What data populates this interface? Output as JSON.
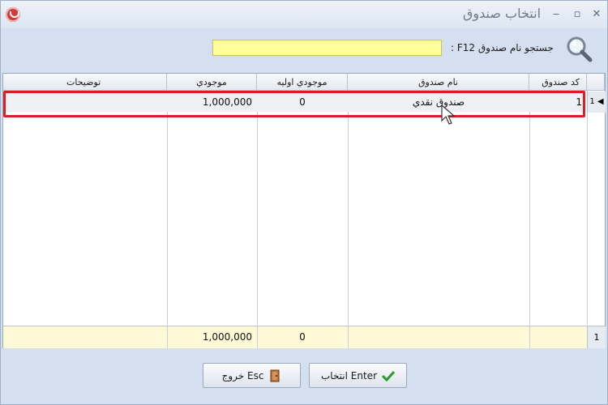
{
  "window": {
    "title": "انتخاب صندوق"
  },
  "search": {
    "label": "جستجو نام صندوق F12 :",
    "value": ""
  },
  "grid": {
    "columns": {
      "code": "کد صندوق",
      "name": "نام صندوق",
      "initial": "موجودي اوليه",
      "balance": "موجودي",
      "description": "توضيحات"
    },
    "rows": [
      {
        "index": "1",
        "code": "1",
        "name": "صندوق نقدي",
        "initial": "0",
        "balance": "1,000,000",
        "description": ""
      }
    ],
    "footer": {
      "count": "1",
      "initial": "0",
      "balance": "1,000,000"
    }
  },
  "buttons": {
    "select": "انتخاب Enter",
    "exit": "خروج Esc"
  },
  "colors": {
    "selection_border": "#d81f26",
    "search_bg": "#ffff99",
    "footer_bg": "#fff9d8"
  }
}
